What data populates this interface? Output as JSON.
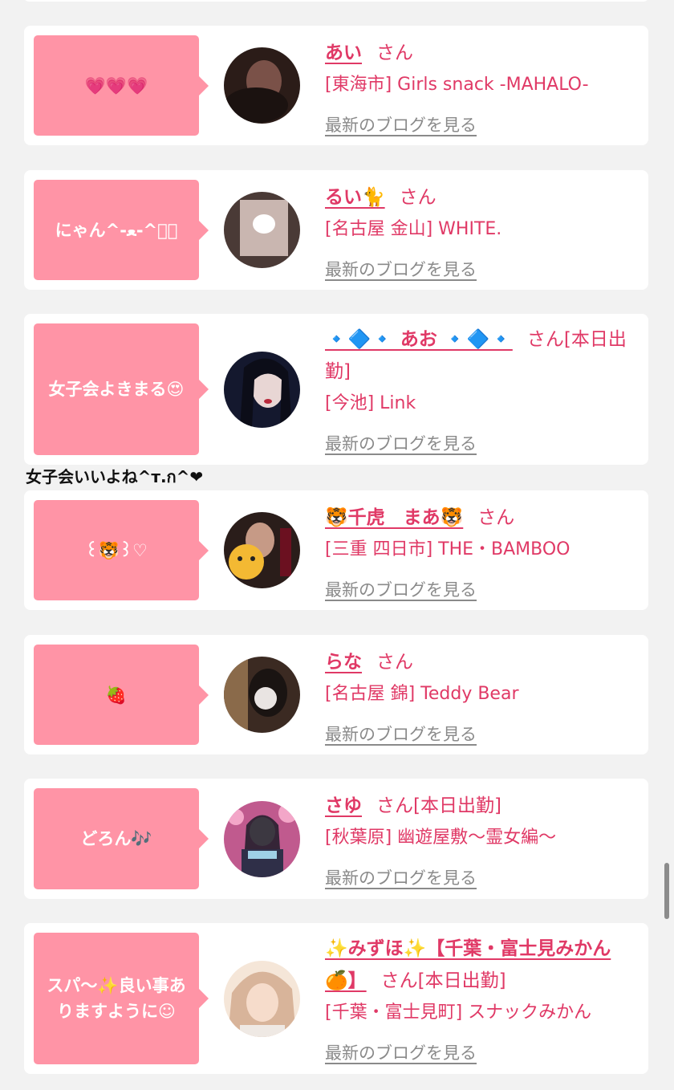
{
  "cards": [
    {
      "bubble": "💗💗💗",
      "name": "あい",
      "san": "さん",
      "shop": "[東海市] Girls snack -MAHALO-",
      "blog": "最新のブログを見る",
      "avatar_colors": [
        "#2b1c18",
        "#7a5148"
      ]
    },
    {
      "bubble": "にゃん^-ﻌ-^ฅ゙",
      "name": "るい🐈",
      "san": "さん",
      "shop": "[名古屋 金山] WHITE.",
      "blog": "最新のブログを見る",
      "avatar_colors": [
        "#4a3a36",
        "#c9b6b0"
      ]
    },
    {
      "bubble": "女子会よきまる😍",
      "name": "🔹🔷🔹 あお 🔹🔷🔹",
      "san": "さん[本日出勤]",
      "shop": "[今池] Link",
      "blog": "最新のブログを見る",
      "avatar_colors": [
        "#14182e",
        "#6b7aa8"
      ]
    },
    {
      "bubble": "꒰🐯꒱♡",
      "name": "🐯千虎　まあ🐯",
      "san": "さん",
      "shop": "[三重 四日市] THE・BAMBOO",
      "blog": "最新のブログを見る",
      "avatar_colors": [
        "#2a1d1a",
        "#f3b933"
      ]
    },
    {
      "bubble": "🍓",
      "name": "らな",
      "san": "さん",
      "shop": "[名古屋 錦] Teddy Bear",
      "blog": "最新のブログを見る",
      "avatar_colors": [
        "#3b2a22",
        "#e9e4e2"
      ]
    },
    {
      "bubble": "どろん🎶",
      "name": "さゆ",
      "san": "さん[本日出勤]",
      "shop": "[秋葉原] 幽遊屋敷〜霊女編〜",
      "blog": "最新のブログを見る",
      "avatar_colors": [
        "#c05a8e",
        "#2f2f48"
      ]
    },
    {
      "bubble": "スパ〜✨良い事ありますように☺︎",
      "name": "✨みずほ✨【千葉・富士見みかん🍊】",
      "san": "さん[本日出勤]",
      "shop": "[千葉・富士見町] スナックみかん",
      "blog": "最新のブログを見る",
      "avatar_colors": [
        "#d8b49a",
        "#f5e6d8"
      ]
    }
  ],
  "note": "女子会いいよね^ᴛ.ก^❤"
}
